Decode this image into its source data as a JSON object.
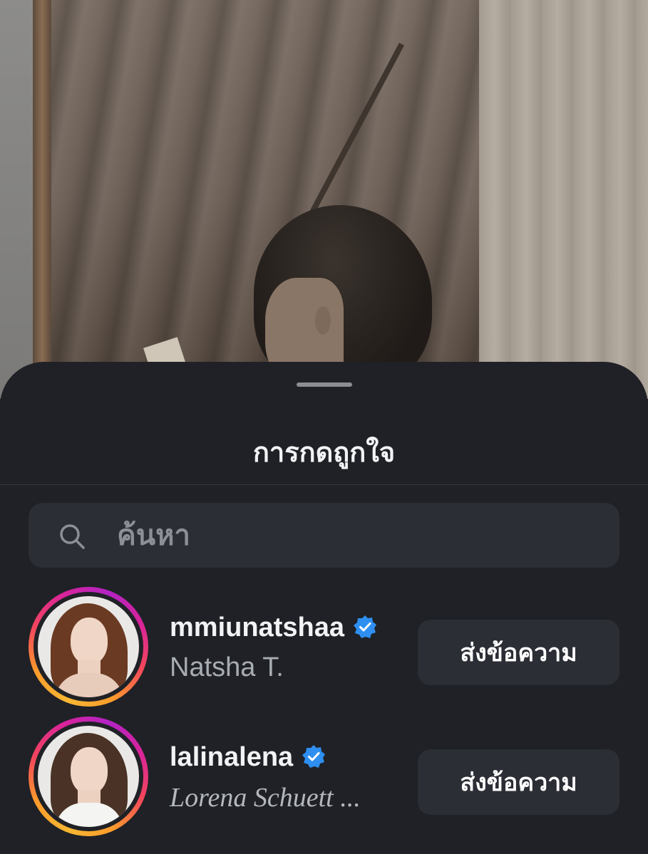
{
  "sheet": {
    "title": "การกดถูกใจ",
    "search": {
      "placeholder": "ค้นหา",
      "value": ""
    }
  },
  "likes": [
    {
      "username": "mmiunatshaa",
      "full_name": "Natsha T.",
      "verified": true,
      "button_label": "ส่งข้อความ"
    },
    {
      "username": "lalinalena",
      "full_name": "Lorena Schuett ...",
      "verified": true,
      "button_label": "ส่งข้อความ"
    }
  ],
  "colors": {
    "sheet_bg": "#1f2126",
    "field_bg": "#2b2e35",
    "verified_blue": "#2e8ff0",
    "secondary_text": "#a8acb3"
  },
  "icons": [
    "search-icon",
    "verified-badge-icon"
  ]
}
